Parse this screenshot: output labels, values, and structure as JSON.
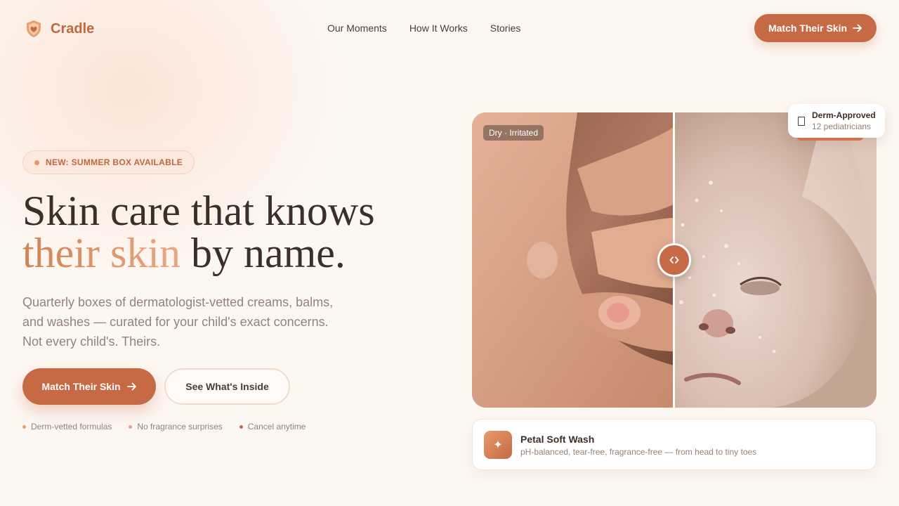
{
  "brand": {
    "name": "Cradle",
    "icon": "shield-heart-icon",
    "color": "#c0673f"
  },
  "nav": {
    "links": [
      "Our Moments",
      "How It Works",
      "Stories"
    ],
    "cta": "Match Their Skin"
  },
  "hero": {
    "pill": "NEW: SUMMER BOX AVAILABLE",
    "headline_line1": "Skin care that knows",
    "headline_accent": "their skin",
    "headline_rest": " by name.",
    "subtitle_lines": [
      "Quarterly boxes of dermatologist-vetted creams, balms,",
      "and washes — curated for your child's exact concerns.",
      "Not every child's. Theirs."
    ],
    "primary_button": "Match Their Skin",
    "secondary_button": "See What's Inside",
    "features": [
      {
        "label": "Derm-vetted formulas",
        "color": "#e8a36e"
      },
      {
        "label": "No fragrance surprises",
        "color": "#e5a195"
      },
      {
        "label": "Cancel anytime",
        "color": "#c56a55"
      }
    ]
  },
  "comparison": {
    "before_tag": "Dry · Irritated",
    "handle_icon": "chevrons-left-right-icon",
    "badge_title": "Derm-Approved",
    "badge_subtitle": "12 pediatricians"
  },
  "product": {
    "icon": "sparkle-icon",
    "name": "Petal Soft Wash",
    "description": "pH-balanced, tear-free, fragrance-free — from head to tiny toes"
  },
  "colors": {
    "accent": "#c56a45",
    "background": "#fdf7f2",
    "text": "#3d2f28",
    "muted": "#948378"
  }
}
